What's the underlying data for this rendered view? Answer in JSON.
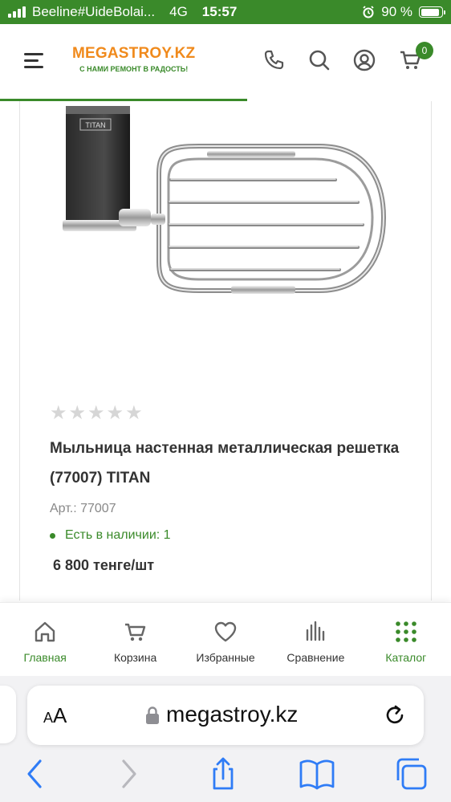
{
  "status_bar": {
    "carrier": "Beeline#UideBolai...",
    "network": "4G",
    "time": "15:57",
    "battery": "90 %",
    "battery_level": 0.9
  },
  "header": {
    "logo_name": "MEGASTROY.KZ",
    "logo_tagline": "С НАМИ РЕМОНТ В РАДОСТЬ!",
    "cart_count": "0"
  },
  "product": {
    "image_label": "TITAN",
    "title": "Мыльница настенная металлическая решетка (77007) TITAN",
    "sku": "Арт.: 77007",
    "stock": "Есть в наличии: 1",
    "price": "6 800 тенге/шт",
    "rating": 0,
    "stars_total": 5
  },
  "bottom_nav": [
    {
      "label": "Главная",
      "icon": "home-icon"
    },
    {
      "label": "Корзина",
      "icon": "cart-icon"
    },
    {
      "label": "Избранные",
      "icon": "heart-icon"
    },
    {
      "label": "Сравнение",
      "icon": "compare-icon"
    },
    {
      "label": "Каталог",
      "icon": "grid-icon"
    }
  ],
  "browser": {
    "text_size_label_small": "A",
    "text_size_label_large": "A",
    "url": "megastroy.kz"
  },
  "colors": {
    "brand_green": "#3a8a2a",
    "brand_orange": "#f08a1c",
    "ios_blue": "#2f7cf6"
  }
}
